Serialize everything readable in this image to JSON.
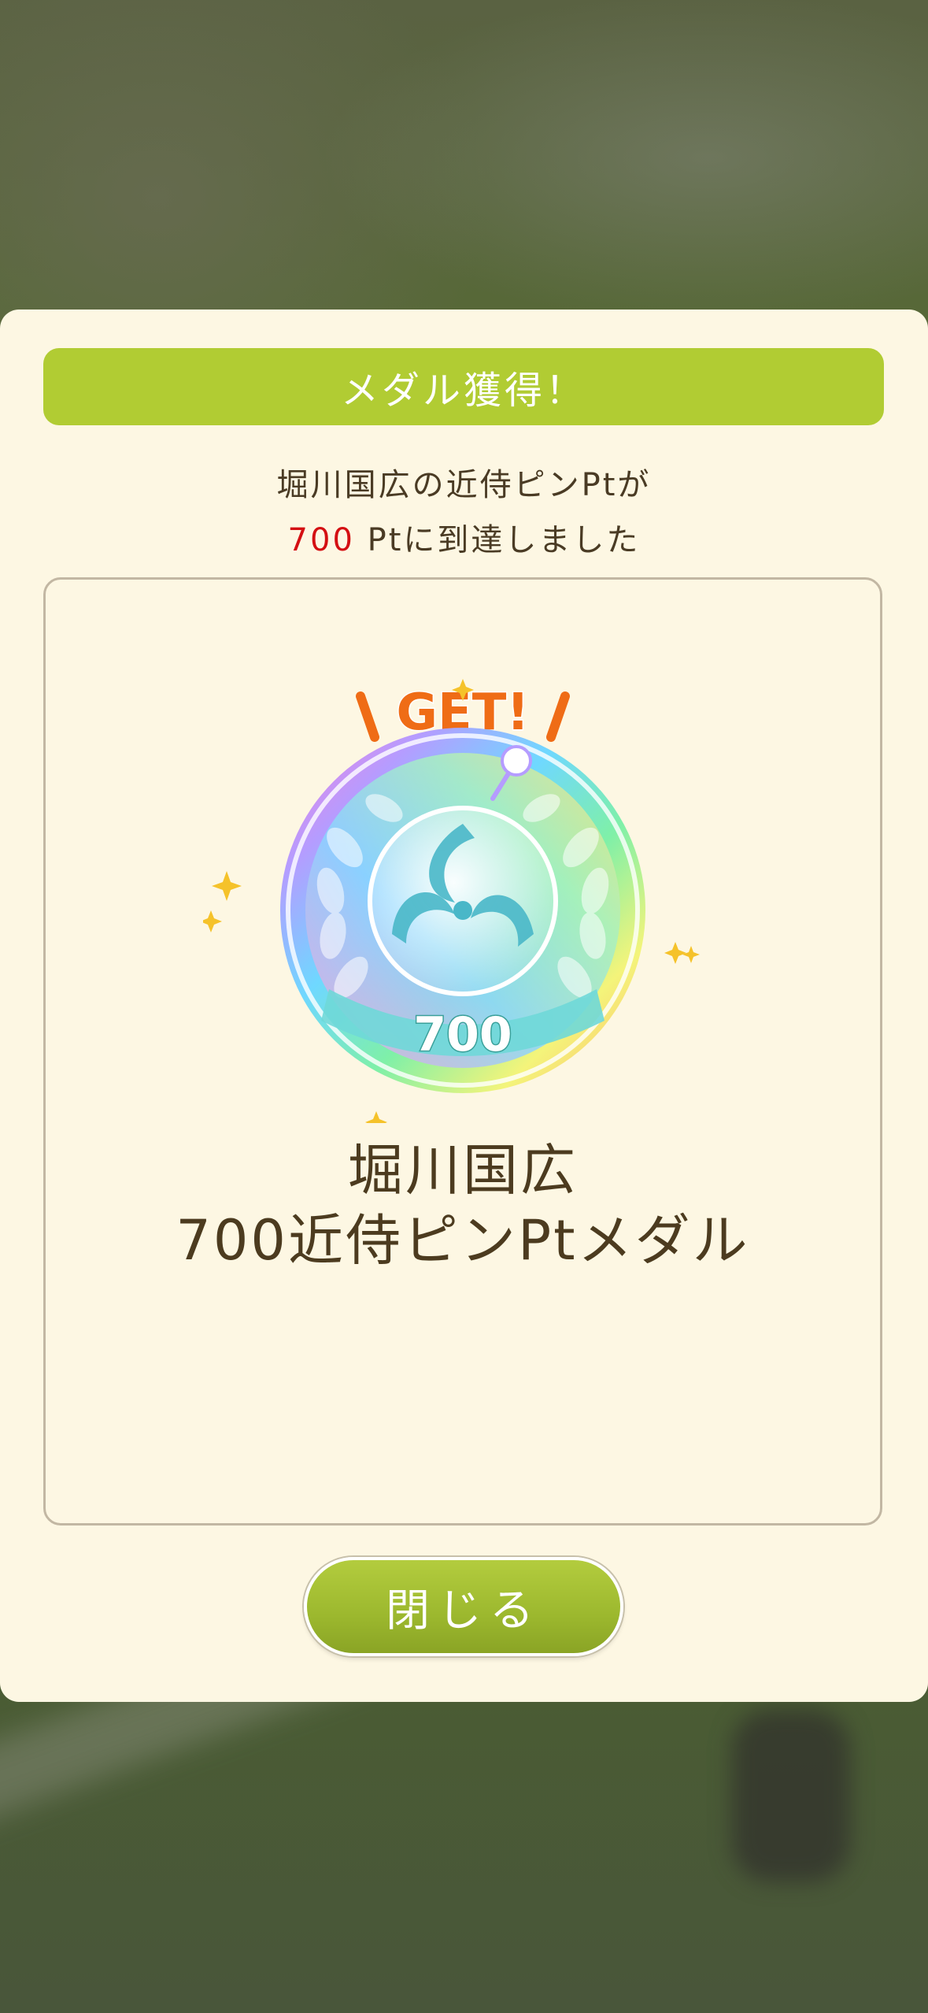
{
  "modal": {
    "title": "メダル獲得！",
    "message_line1": "堀川国広の近侍ピンPtが",
    "message_value": "700",
    "message_line2_rest": " Ptに到達しました",
    "close_label": "閉じる"
  },
  "medal": {
    "badge_text": "GET!",
    "value_text": "700",
    "name_line1": "堀川国広",
    "name_line2": "700近侍ピンPtメダル"
  },
  "colors": {
    "accent_green": "#b1cc33",
    "highlight_red": "#d40f12",
    "panel": "#fdf7e3",
    "text_brown": "#4c3b1f",
    "get_orange": "#ef6c16"
  },
  "icons": {
    "medal": "rainbow-medal-icon",
    "sparkle": "sparkle-icon"
  }
}
